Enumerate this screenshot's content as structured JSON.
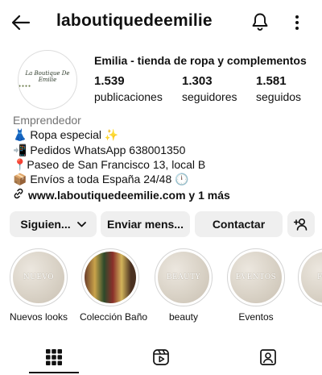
{
  "header": {
    "username": "laboutiquedeemilie"
  },
  "profile": {
    "avatar_text_line1": "La Boutique De Emilie",
    "avatar_text_line2": "●●●●",
    "full_name": "Emilia - tienda de ropa y complementos",
    "stats": [
      {
        "value": "1.539",
        "label": "publicaciones"
      },
      {
        "value": "1.303",
        "label": "seguidores"
      },
      {
        "value": "1.581",
        "label": "seguidos"
      }
    ],
    "category": "Emprendedor",
    "bio": [
      "👗 Ropa especial ✨",
      "📲 Pedidos WhatsApp 638001350",
      "📍Paseo de San Francisco 13, local B",
      "📦 Envíos a toda España 24/48 🕛"
    ],
    "link": "www.laboutiquedeemilie.com y 1 más"
  },
  "actions": {
    "following": "Siguien...",
    "message": "Enviar mens...",
    "contact": "Contactar"
  },
  "highlights": [
    {
      "label": "Nuevos looks",
      "cover_text": "NUEVO"
    },
    {
      "label": "Colección Baño",
      "cover_text": ""
    },
    {
      "label": "beauty",
      "cover_text": "BEAUTY"
    },
    {
      "label": "Eventos",
      "cover_text": "EVENTOS"
    },
    {
      "label": "",
      "cover_text": "FI"
    }
  ],
  "tabs": [
    "grid",
    "reels",
    "tagged"
  ],
  "colors": {
    "background": "#ffffff",
    "button_bg": "#efefef",
    "text": "#111111",
    "muted": "#737373"
  }
}
